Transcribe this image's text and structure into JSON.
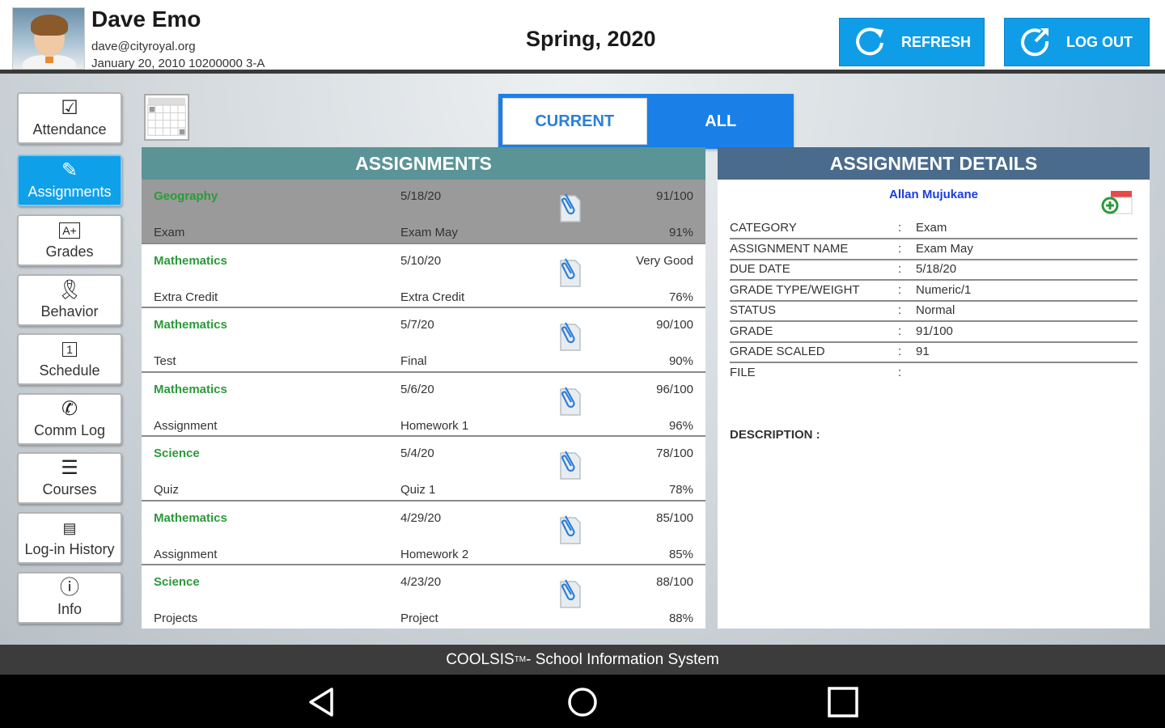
{
  "header": {
    "user_name": "Dave Emo",
    "email": "dave@cityroyal.org",
    "meta": "January 20, 2010 10200000 3-A",
    "term": "Spring, 2020",
    "refresh_label": "REFRESH",
    "logout_label": "LOG OUT"
  },
  "sidebar": {
    "items": [
      {
        "label": "Attendance",
        "icon": "checkbox-icon"
      },
      {
        "label": "Assignments",
        "icon": "eraser-icon"
      },
      {
        "label": "Grades",
        "icon": "grade-icon"
      },
      {
        "label": "Behavior",
        "icon": "ribbon-icon"
      },
      {
        "label": "Schedule",
        "icon": "calendar-day-icon"
      },
      {
        "label": "Comm Log",
        "icon": "phone-icon"
      },
      {
        "label": "Courses",
        "icon": "books-icon"
      },
      {
        "label": "Log-in History",
        "icon": "history-icon"
      },
      {
        "label": "Info",
        "icon": "info-icon"
      }
    ],
    "active": "Assignments"
  },
  "toggle": {
    "current_label": "CURRENT",
    "all_label": "ALL",
    "selected": "ALL"
  },
  "assignments": {
    "title": "ASSIGNMENTS",
    "rows": [
      {
        "subject": "Geography",
        "date": "5/18/20",
        "score": "91/100",
        "category": "Exam",
        "name": "Exam May",
        "pct": "91%"
      },
      {
        "subject": "Mathematics",
        "date": "5/10/20",
        "score": "Very Good",
        "category": "Extra Credit",
        "name": "Extra Credit",
        "pct": "76%"
      },
      {
        "subject": "Mathematics",
        "date": "5/7/20",
        "score": "90/100",
        "category": "Test",
        "name": "Final",
        "pct": "90%"
      },
      {
        "subject": "Mathematics",
        "date": "5/6/20",
        "score": "96/100",
        "category": "Assignment",
        "name": "Homework 1",
        "pct": "96%"
      },
      {
        "subject": "Science",
        "date": "5/4/20",
        "score": "78/100",
        "category": "Quiz",
        "name": "Quiz 1",
        "pct": "78%"
      },
      {
        "subject": "Mathematics",
        "date": "4/29/20",
        "score": "85/100",
        "category": "Assignment",
        "name": "Homework 2",
        "pct": "85%"
      },
      {
        "subject": "Science",
        "date": "4/23/20",
        "score": "88/100",
        "category": "Projects",
        "name": "Project",
        "pct": "88%"
      }
    ],
    "selected_index": 0
  },
  "details": {
    "title": "ASSIGNMENT DETAILS",
    "teacher": "Allan Mujukane",
    "fields": [
      {
        "label": "CATEGORY",
        "value": "Exam"
      },
      {
        "label": "ASSIGNMENT NAME",
        "value": "Exam May"
      },
      {
        "label": "DUE DATE",
        "value": "5/18/20"
      },
      {
        "label": "GRADE TYPE/WEIGHT",
        "value": "Numeric/1"
      },
      {
        "label": "STATUS",
        "value": "Normal"
      },
      {
        "label": "GRADE",
        "value": "91/100"
      },
      {
        "label": "GRADE SCALED",
        "value": "91"
      },
      {
        "label": "FILE",
        "value": ""
      }
    ],
    "separator": ":",
    "description_label": "DESCRIPTION :"
  },
  "footer": {
    "brand": "COOLSIS",
    "tm": "TM",
    "text": " - School Information System"
  },
  "colors": {
    "accent": "#0f9de8",
    "toggle_blue": "#1a80e8",
    "assign_head": "#5b9497",
    "detail_head": "#4a6b8c",
    "subject_green": "#2c9a3a",
    "teacher_blue": "#1a3ee0"
  }
}
